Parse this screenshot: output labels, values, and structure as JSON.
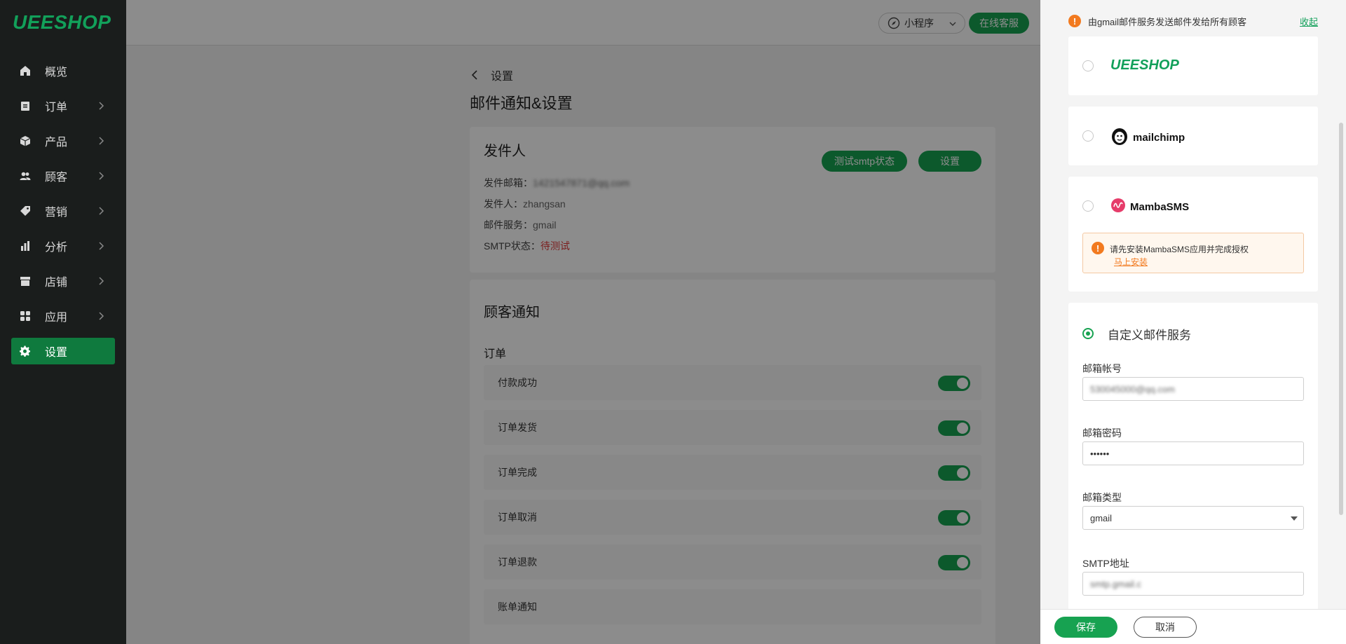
{
  "brand": {
    "logo": "UEESHOP"
  },
  "sidebar": {
    "items": [
      {
        "label": "概览",
        "icon": "home-icon"
      },
      {
        "label": "订单",
        "icon": "clipboard-icon"
      },
      {
        "label": "产品",
        "icon": "box-icon"
      },
      {
        "label": "顾客",
        "icon": "users-icon"
      },
      {
        "label": "营销",
        "icon": "tag-icon"
      },
      {
        "label": "分析",
        "icon": "bar-chart-icon"
      },
      {
        "label": "店铺",
        "icon": "store-icon"
      },
      {
        "label": "应用",
        "icon": "apps-icon"
      },
      {
        "label": "设置",
        "icon": "gear-icon",
        "active": true
      }
    ]
  },
  "topbar": {
    "mini_program": "小程序",
    "online_service": "在线客服"
  },
  "main": {
    "back_label": "设置",
    "title": "邮件通知&设置",
    "sender": {
      "title": "发件人",
      "test_button": "测试smtp状态",
      "settings_button": "设置",
      "email_label": "发件邮箱：",
      "email_value": "1421547871@qq.com",
      "name_label": "发件人：",
      "name_value": "zhangsan",
      "service_label": "邮件服务：",
      "service_value": "gmail",
      "smtp_label": "SMTP状态：",
      "smtp_value": "待测试"
    },
    "customer_notify": {
      "title": "顾客通知",
      "order_heading": "订单",
      "rows": [
        "付款成功",
        "订单发货",
        "订单完成",
        "订单取消",
        "订单退款",
        "账单通知"
      ]
    }
  },
  "drawer": {
    "notice": "由gmail邮件服务发送邮件发给所有顾客",
    "collapse_link": "收起",
    "providers": {
      "ueeshop": "UEESHOP",
      "mailchimp": "mailchimp",
      "mambasms": "MambaSMS"
    },
    "mamba_alert_text": "请先安装MambaSMS应用并完成授权",
    "mamba_alert_link": "马上安装",
    "custom_title": "自定义邮件服务",
    "account_label": "邮箱帐号",
    "account_value": "530045000@qq.com",
    "password_label": "邮箱密码",
    "password_value": "••••••",
    "type_label": "邮箱类型",
    "type_value": "gmail",
    "smtp_label": "SMTP地址",
    "smtp_value": "smtp.gmail.c",
    "save_button": "保存",
    "cancel_button": "取消"
  },
  "colors": {
    "accent": "#17a251",
    "warning": "#f27a1f",
    "sidebar_bg": "#1a1d1c"
  }
}
